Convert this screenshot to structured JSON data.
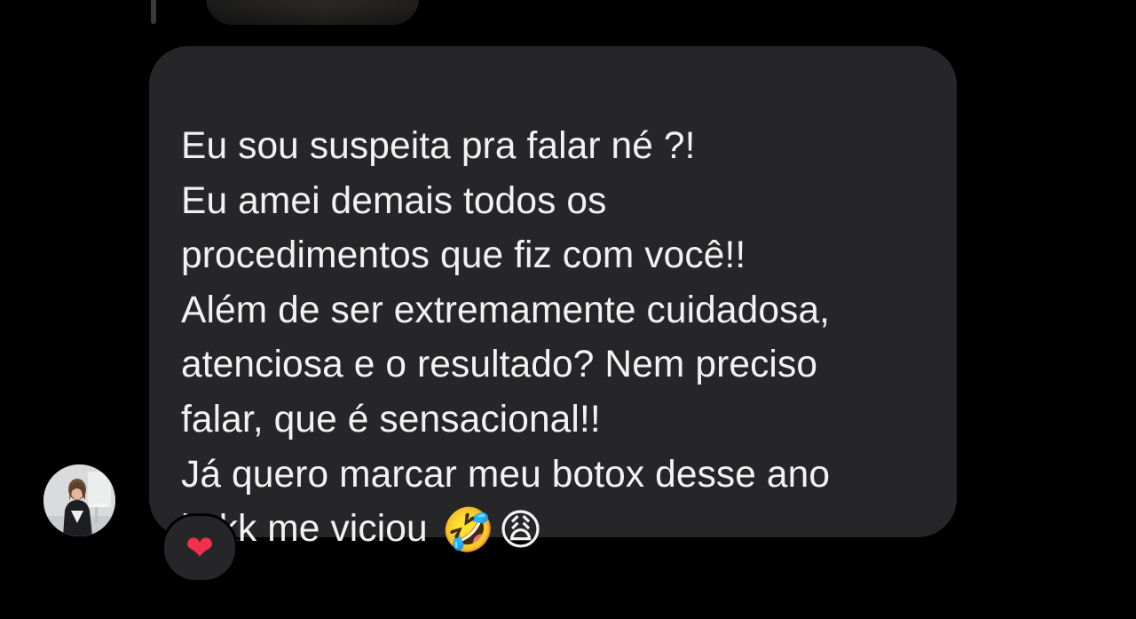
{
  "thread": {
    "previous_message": {
      "type": "media"
    },
    "message": {
      "lines": [
        "Eu sou suspeita pra falar né ?!",
        "Eu amei demais todos os",
        "procedimentos que fiz com você!!",
        "Além de ser extremamente cuidadosa,",
        "atenciosa e o resultado? Nem preciso",
        "falar, que é sensacional!!",
        "Já quero marcar meu botox desse ano",
        "kkkk me viciou"
      ],
      "emoji_1": "🤣",
      "emoji_2": "😩"
    },
    "reaction": {
      "emoji": "❤",
      "icon": "heart-icon"
    },
    "sender_avatar": {
      "icon": "avatar"
    }
  },
  "colors": {
    "background": "#000000",
    "bubble": "#262628",
    "text": "#f2f2f2",
    "reaction_heart": "#f2304c"
  }
}
